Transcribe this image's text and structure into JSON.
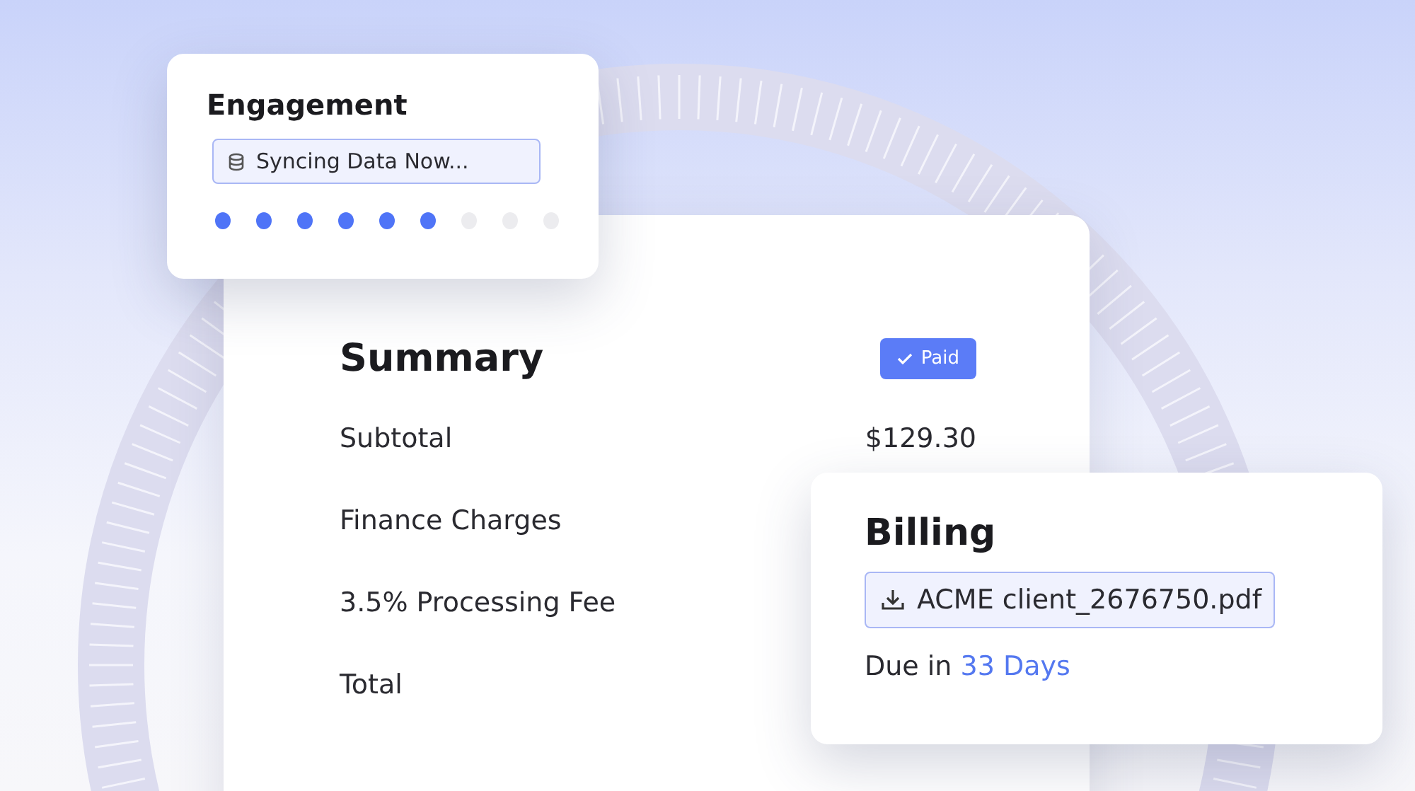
{
  "engagement": {
    "title": "Engagement",
    "status": "Syncing Data Now...",
    "steps": [
      {
        "done": true
      },
      {
        "done": true
      },
      {
        "done": true
      },
      {
        "done": true
      },
      {
        "done": true
      },
      {
        "done": true
      },
      {
        "done": false
      },
      {
        "done": false
      },
      {
        "done": false
      }
    ]
  },
  "summary": {
    "title": "Summary",
    "badge": {
      "label": "Paid",
      "checked": true
    },
    "rows": [
      {
        "label": "Subtotal",
        "value": "$129.30"
      },
      {
        "label": "Finance Charges"
      },
      {
        "label": "3.5% Processing Fee"
      },
      {
        "label": "Total"
      }
    ]
  },
  "billing": {
    "title": "Billing",
    "file": "ACME client_2676750.pdf",
    "due_prefix": "Due in",
    "due_value": "33 Days"
  }
}
